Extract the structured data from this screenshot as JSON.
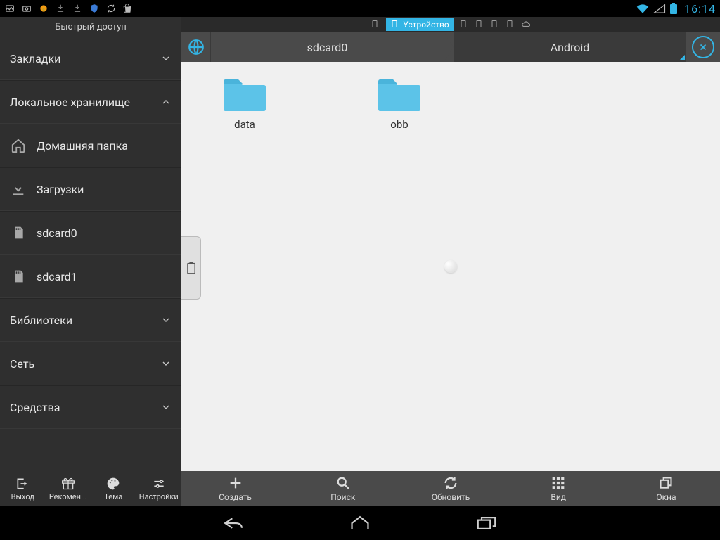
{
  "status": {
    "clock": "16:14"
  },
  "sidebar": {
    "title": "Быстрый доступ",
    "sections": {
      "bookmarks": "Закладки",
      "local": "Локальное хранилище",
      "libraries": "Библиотеки",
      "network": "Сеть",
      "tools": "Средства"
    },
    "local_items": [
      {
        "label": "Домашняя папка",
        "icon": "home-icon"
      },
      {
        "label": "Загрузки",
        "icon": "download-icon"
      },
      {
        "label": "sdcard0",
        "icon": "sd-icon"
      },
      {
        "label": "sdcard1",
        "icon": "sd-icon"
      }
    ],
    "bottom": [
      {
        "label": "Выход"
      },
      {
        "label": "Рекомен..."
      },
      {
        "label": "Тема"
      },
      {
        "label": "Настройки"
      }
    ]
  },
  "tab": {
    "label": "Устройство"
  },
  "breadcrumb": {
    "segments": [
      "sdcard0",
      "Android"
    ]
  },
  "folders": [
    {
      "name": "data"
    },
    {
      "name": "obb"
    }
  ],
  "main_bottom": [
    {
      "label": "Создать"
    },
    {
      "label": "Поиск"
    },
    {
      "label": "Обновить"
    },
    {
      "label": "Вид"
    },
    {
      "label": "Окна"
    }
  ]
}
